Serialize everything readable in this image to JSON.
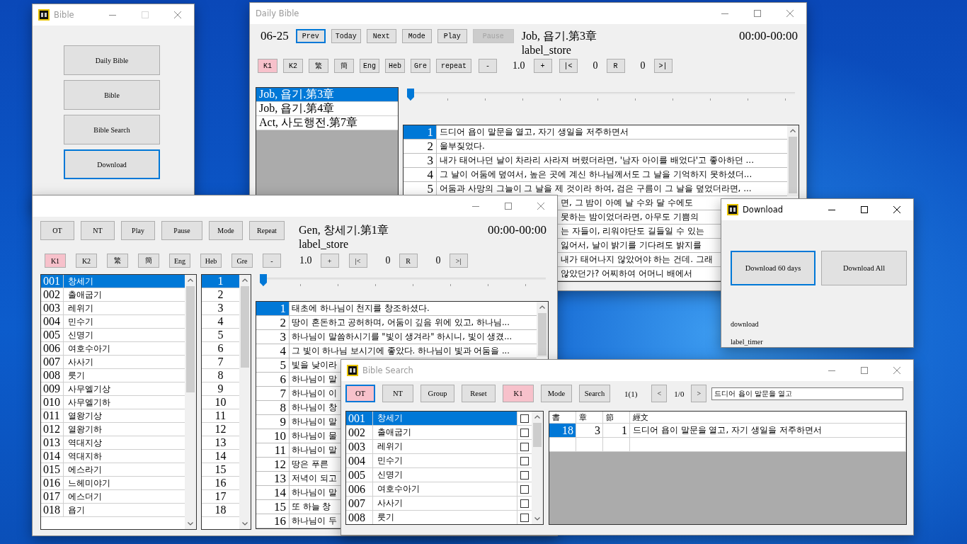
{
  "windows": [
    {
      "kind": "launcher",
      "title": "Bible",
      "active": false,
      "buttons": [
        {
          "label": "Daily Bible",
          "focused": false
        },
        {
          "label": "Bible",
          "focused": false
        },
        {
          "label": "Bible Search",
          "focused": false
        },
        {
          "label": "Download",
          "focused": true
        }
      ]
    },
    {
      "kind": "daily",
      "title": "Daily Bible",
      "active": false,
      "date": "06-25",
      "buttons": [
        {
          "label": "Prev",
          "focused": true,
          "disabled": false
        },
        {
          "label": "Today",
          "focused": false,
          "disabled": false
        },
        {
          "label": "Next",
          "focused": false,
          "disabled": false
        },
        {
          "label": "Mode",
          "focused": false,
          "disabled": false
        },
        {
          "label": "Play",
          "focused": false,
          "disabled": false
        },
        {
          "label": "Pause",
          "focused": false,
          "disabled": true
        }
      ],
      "reference": "Job, 욥기.第3章",
      "status": "label_store",
      "time": "00:00-00:00",
      "controls": [
        {
          "kind": "toggle",
          "label": "K1",
          "on": true
        },
        {
          "kind": "toggle",
          "label": "K2",
          "on": false
        },
        {
          "kind": "toggle",
          "label": "繁",
          "on": false
        },
        {
          "kind": "toggle",
          "label": "簡",
          "on": false
        },
        {
          "kind": "toggle",
          "label": "Eng",
          "on": false
        },
        {
          "kind": "toggle",
          "label": "Heb",
          "on": false
        },
        {
          "kind": "toggle",
          "label": "Gre",
          "on": false
        },
        {
          "kind": "button",
          "label": "repeat"
        },
        {
          "kind": "button",
          "label": "-"
        },
        {
          "kind": "value",
          "label": "1.0"
        },
        {
          "kind": "button",
          "label": "+"
        },
        {
          "kind": "button",
          "label": "|<"
        },
        {
          "kind": "value",
          "label": "0"
        },
        {
          "kind": "button",
          "label": "R"
        },
        {
          "kind": "value",
          "label": "0"
        },
        {
          "kind": "button",
          "label": ">|"
        }
      ],
      "slider": {
        "level": 0
      },
      "readings": [
        {
          "label": "Job, 욥기.第3章",
          "selected": true
        },
        {
          "label": "Job, 욥기.第4章",
          "selected": false
        },
        {
          "label": "Act, 사도행전.第7章",
          "selected": false
        }
      ],
      "verses": [
        {
          "kind": "full",
          "number": "1",
          "text": "드디어 욥이 말문을 열고, 자기 생일을 저주하면서",
          "selected": true
        },
        {
          "kind": "full",
          "number": "2",
          "text": "울부짖었다.",
          "selected": false
        },
        {
          "kind": "full",
          "number": "3",
          "text": "내가 태어나던 날이 차라리 사라져 버렸더라면, '남자 아이를 배었다'고 좋아하던 ...",
          "selected": false
        },
        {
          "kind": "full",
          "number": "4",
          "text": "그 날이 어둠에 덮여서, 높은 곳에 계신 하나님께서도 그 날을 기억하지 못하셨더...",
          "selected": false
        },
        {
          "kind": "full",
          "number": "5",
          "text": "어둠과 사망의 그늘이 그 날을 제 것이라 하여, 검은 구름이 그 날을 덮었더라면, ...",
          "selected": false
        },
        {
          "kind": "covered",
          "text": "면, 그 밤이 아예 날 수와 달 수에도"
        },
        {
          "kind": "covered",
          "text": "못하는 밤이었더라면, 아무도 기쁨의"
        },
        {
          "kind": "covered",
          "text": "는 자들이, 리워야단도 길들일 수 있는"
        },
        {
          "kind": "covered",
          "text": "잃어서, 날이 밝기를 기다려도 밝지를"
        },
        {
          "kind": "covered",
          "text": "내가 태어나지 않았어야 하는 건데. 그래"
        },
        {
          "kind": "covered",
          "text": "않았던가? 어찌하여 어머니 배에서"
        }
      ]
    },
    {
      "kind": "bible",
      "buttons": [
        "OT",
        "NT",
        "Play",
        "Pause",
        "Mode",
        "Repeat"
      ],
      "reference": "Gen, 창세기.第1章",
      "status": "label_store",
      "time": "00:00-00:00",
      "controls": [
        {
          "kind": "toggle",
          "label": "K1",
          "on": true
        },
        {
          "kind": "toggle",
          "label": "K2",
          "on": false
        },
        {
          "kind": "toggle",
          "label": "繁",
          "on": false
        },
        {
          "kind": "toggle",
          "label": "簡",
          "on": false
        },
        {
          "kind": "toggle",
          "label": "Eng",
          "on": false
        },
        {
          "kind": "toggle",
          "label": "Heb",
          "on": false
        },
        {
          "kind": "toggle",
          "label": "Gre",
          "on": false
        },
        {
          "kind": "button",
          "label": "-"
        },
        {
          "kind": "value",
          "label": "1.0"
        },
        {
          "kind": "button",
          "label": "+"
        },
        {
          "kind": "button",
          "label": "|<"
        },
        {
          "kind": "value",
          "label": "0"
        },
        {
          "kind": "button",
          "label": "R"
        },
        {
          "kind": "value",
          "label": "0"
        },
        {
          "kind": "button",
          "label": ">|"
        }
      ],
      "slider": {
        "level": 0
      },
      "books": [
        {
          "number": "001",
          "name": "창세기",
          "selected": true
        },
        {
          "number": "002",
          "name": "출애굽기",
          "selected": false
        },
        {
          "number": "003",
          "name": "레위기",
          "selected": false
        },
        {
          "number": "004",
          "name": "민수기",
          "selected": false
        },
        {
          "number": "005",
          "name": "신명기",
          "selected": false
        },
        {
          "number": "006",
          "name": "여호수아기",
          "selected": false
        },
        {
          "number": "007",
          "name": "사사기",
          "selected": false
        },
        {
          "number": "008",
          "name": "룻기",
          "selected": false
        },
        {
          "number": "009",
          "name": "사무엘기상",
          "selected": false
        },
        {
          "number": "010",
          "name": "사무엘기하",
          "selected": false
        },
        {
          "number": "011",
          "name": "열왕기상",
          "selected": false
        },
        {
          "number": "012",
          "name": "열왕기하",
          "selected": false
        },
        {
          "number": "013",
          "name": "역대지상",
          "selected": false
        },
        {
          "number": "014",
          "name": "역대지하",
          "selected": false
        },
        {
          "number": "015",
          "name": "에스라기",
          "selected": false
        },
        {
          "number": "016",
          "name": "느헤미야기",
          "selected": false
        },
        {
          "number": "017",
          "name": "에스더기",
          "selected": false
        },
        {
          "number": "018",
          "name": "욥기",
          "selected": false
        }
      ],
      "chapters": [
        {
          "label": "1",
          "selected": true
        },
        {
          "label": "2",
          "selected": false
        },
        {
          "label": "3",
          "selected": false
        },
        {
          "label": "4",
          "selected": false
        },
        {
          "label": "5",
          "selected": false
        },
        {
          "label": "6",
          "selected": false
        },
        {
          "label": "7",
          "selected": false
        },
        {
          "label": "8",
          "selected": false
        },
        {
          "label": "9",
          "selected": false
        },
        {
          "label": "10",
          "selected": false
        },
        {
          "label": "11",
          "selected": false
        },
        {
          "label": "12",
          "selected": false
        },
        {
          "label": "13",
          "selected": false
        },
        {
          "label": "14",
          "selected": false
        },
        {
          "label": "15",
          "selected": false
        },
        {
          "label": "16",
          "selected": false
        },
        {
          "label": "17",
          "selected": false
        },
        {
          "label": "18",
          "selected": false
        }
      ],
      "verses": [
        {
          "number": "1",
          "text": "태초에 하나님이 천지를 창조하셨다.",
          "selected": true
        },
        {
          "number": "2",
          "text": "땅이 혼돈하고 공허하며, 어둠이 깊음 위에 있고, 하나님...",
          "selected": false
        },
        {
          "number": "3",
          "text": "하나님이 말씀하시기를 \"빛이 생겨라\" 하시니, 빛이 생겼...",
          "selected": false
        },
        {
          "number": "4",
          "text": "그 빛이 하나님 보시기에 좋았다. 하나님이 빛과 어둠을 ...",
          "selected": false
        },
        {
          "number": "5",
          "text": "빛을 낮이라",
          "selected": false
        },
        {
          "number": "6",
          "text": "하나님이 말",
          "selected": false
        },
        {
          "number": "7",
          "text": "하나님이 이",
          "selected": false
        },
        {
          "number": "8",
          "text": "하나님이 창",
          "selected": false
        },
        {
          "number": "9",
          "text": "하나님이 말",
          "selected": false
        },
        {
          "number": "10",
          "text": "하나님이 물",
          "selected": false
        },
        {
          "number": "11",
          "text": "하나님이 말",
          "selected": false
        },
        {
          "number": "12",
          "text": "땅은 푸른",
          "selected": false
        },
        {
          "number": "13",
          "text": "저녁이 되고",
          "selected": false
        },
        {
          "number": "14",
          "text": "하나님이 말",
          "selected": false
        },
        {
          "number": "15",
          "text": "또 하늘 창",
          "selected": false
        },
        {
          "number": "16",
          "text": "하나님이 두",
          "selected": false
        }
      ]
    },
    {
      "kind": "download",
      "title": "Download",
      "active": true,
      "buttons": [
        {
          "label": "Download 60 days",
          "focused": true
        },
        {
          "label": "Download All",
          "focused": false
        }
      ],
      "status": "download",
      "timer": "label_timer"
    },
    {
      "kind": "search",
      "title": "Bible Search",
      "active": false,
      "buttons": [
        {
          "label": "OT",
          "on": true,
          "focused": true
        },
        {
          "label": "NT",
          "on": false,
          "focused": false
        },
        {
          "label": "Group",
          "on": false,
          "focused": false
        },
        {
          "label": "Reset",
          "on": false,
          "focused": false
        },
        {
          "label": "K1",
          "on": true,
          "focused": false
        },
        {
          "label": "Mode",
          "on": false,
          "focused": false
        },
        {
          "label": "Search",
          "on": false,
          "focused": false
        }
      ],
      "count": "1(1)",
      "prev": "<",
      "page": "1/0",
      "next": ">",
      "query": "드디어 욥이 말문을 열고",
      "books": [
        {
          "number": "001",
          "name": "창세기",
          "selected": true,
          "checked": false
        },
        {
          "number": "002",
          "name": "출애굽기",
          "selected": false,
          "checked": false
        },
        {
          "number": "003",
          "name": "레위기",
          "selected": false,
          "checked": false
        },
        {
          "number": "004",
          "name": "민수기",
          "selected": false,
          "checked": false
        },
        {
          "number": "005",
          "name": "신명기",
          "selected": false,
          "checked": false
        },
        {
          "number": "006",
          "name": "여호수아기",
          "selected": false,
          "checked": false
        },
        {
          "number": "007",
          "name": "사사기",
          "selected": false,
          "checked": false
        },
        {
          "number": "008",
          "name": "룻기",
          "selected": false,
          "checked": false
        }
      ],
      "columns": [
        "書",
        "章",
        "節",
        "經文"
      ],
      "rows": [
        {
          "cells": [
            "18",
            "3",
            "1",
            "드디어 욥이 말문을 열고, 자기 생일을 저주하면서"
          ],
          "selected": true
        }
      ]
    }
  ]
}
